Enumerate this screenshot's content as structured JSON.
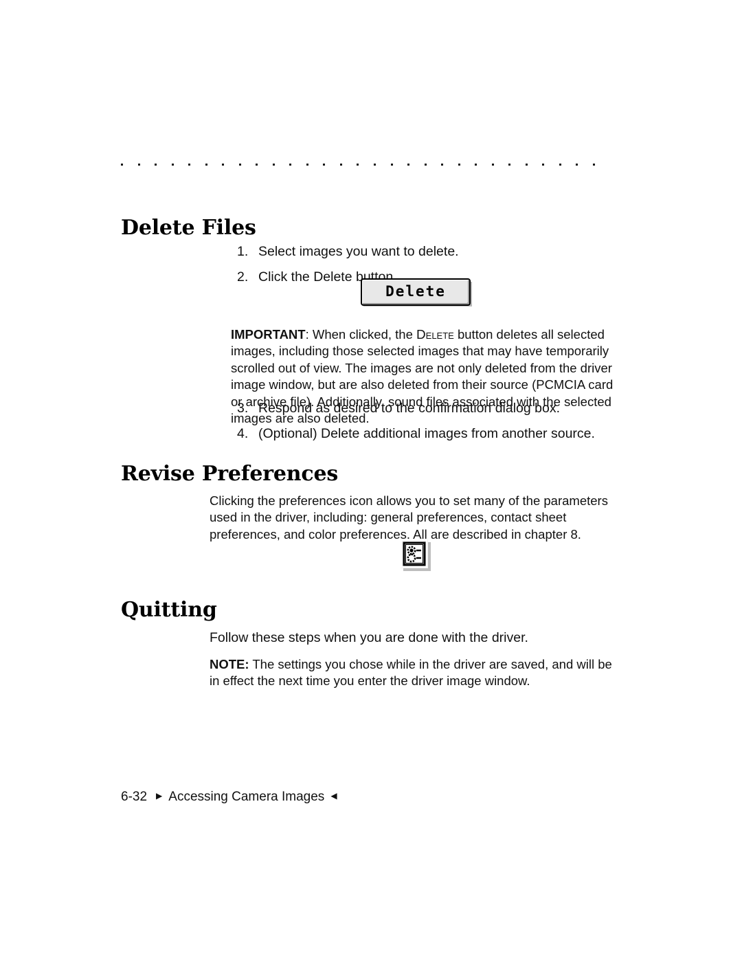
{
  "page": {
    "background": "#ffffff",
    "text_color": "#111111",
    "decorative_rule": {
      "name": "dotted-rule",
      "dot_count": 29,
      "dot_color": "#1a1a1a"
    }
  },
  "sections": {
    "delete_files": {
      "heading": "Delete Files",
      "steps_before_button": [
        {
          "num": "1.",
          "text": "Select images you want to delete."
        },
        {
          "num": "2.",
          "text": "Click the Delete button."
        }
      ],
      "button": {
        "label": "Delete",
        "face_color": "#e8e8e8",
        "shadow_color": "#b9b9b9",
        "border_color": "#000000"
      },
      "important_note": {
        "lead": "IMPORTANT",
        "lead_suffix": ": When clicked, the ",
        "smallcaps_word": "Delete",
        "body": " button deletes all selected images, including those selected images that may have temporarily scrolled out of view. The images are not only deleted from the driver image window, but are also deleted from their source (PCMCIA card or archive file). Additionally, sound files associated with the selected images are also deleted."
      },
      "steps_after_button": [
        {
          "num": "3.",
          "text": "Respond as desired to the confirmation dialog box."
        },
        {
          "num": "4.",
          "text": "(Optional) Delete additional images from another source."
        }
      ]
    },
    "revise_preferences": {
      "heading": "Revise Preferences",
      "body": "Clicking the preferences icon allows you to set many of the parameters used in the driver, including: general preferences, contact sheet preferences, and color preferences. All are described in chapter 8.",
      "icon": {
        "name": "preferences-icon",
        "description": "settings-sliders-icon"
      }
    },
    "quitting": {
      "heading": "Quitting",
      "body": "Follow these steps when you are done with the driver.",
      "note": {
        "lead": "NOTE:",
        "body": " The settings you chose while in the driver are saved, and will be in effect the next time you enter the driver image window."
      }
    }
  },
  "footer": {
    "page_number": "6-32",
    "triangle_left": "▶",
    "title": "Accessing Camera Images",
    "triangle_right": "◀"
  }
}
